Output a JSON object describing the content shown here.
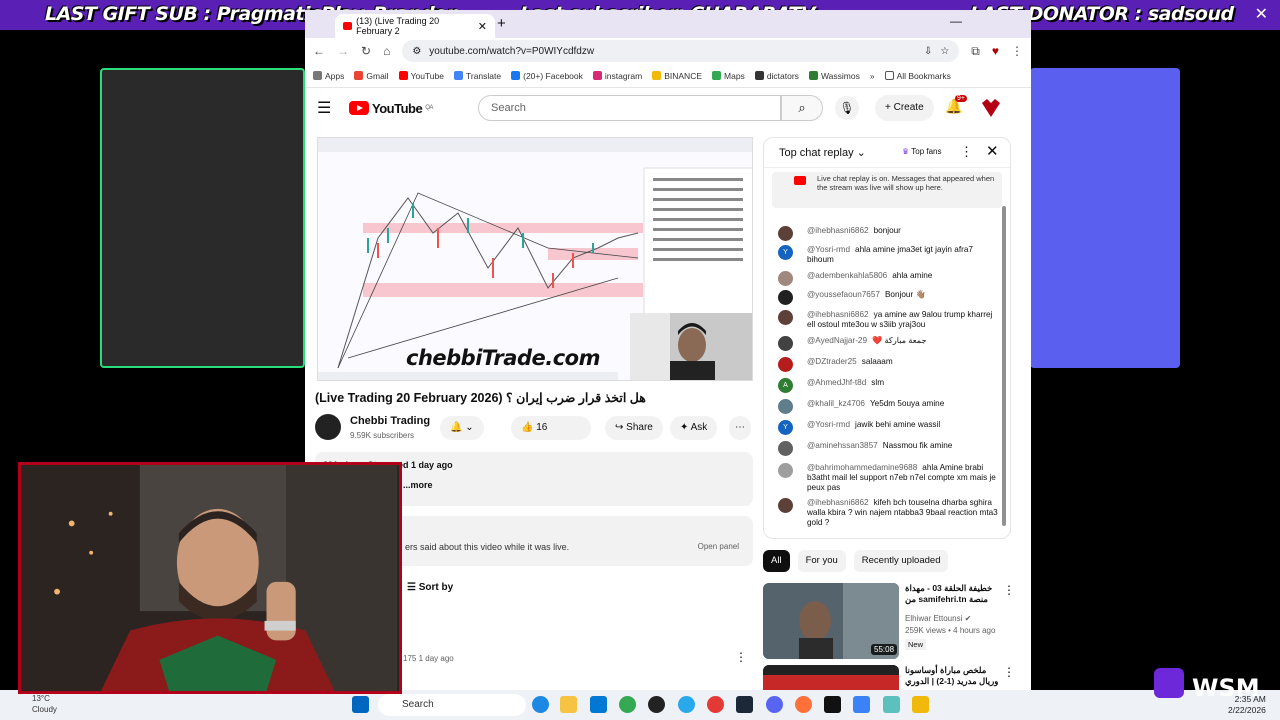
{
  "overlay": {
    "last_gift_sub": "LAST GIFT SUB : PragmaticPlay_Brandon",
    "last_subscriber": "Last subscriber: CHARARATV",
    "last_donator": "LAST DONATOR : sadsoud"
  },
  "browser": {
    "tab_title": "(13) (Live Trading 20 February 2",
    "url": "youtube.com/watch?v=P0WIYcdfdzw",
    "bookmarks": [
      "Apps",
      "Gmail",
      "YouTube",
      "Translate",
      "(20+) Facebook",
      "instagram",
      "BINANCE",
      "Maps",
      "dictators",
      "Wassimos"
    ],
    "all_bookmarks": "All Bookmarks"
  },
  "youtube": {
    "logo_text": "YouTube",
    "logo_country": "QA",
    "search_placeholder": "Search",
    "create_label": "Create",
    "notif_badge": "9+",
    "video_watermark": "chebbiTrade.com",
    "video_title": "(Live Trading 20 February 2026) هل اتخذ قرار ضرب إيران ؟",
    "channel_name": "Chebbi Trading",
    "channel_subs": "9.59K subscribers",
    "likes": "16",
    "share_label": "Share",
    "ask_label": "Ask",
    "desc_stats": "291 views  Streamed 1 day ago",
    "desc_more": "...more",
    "livechat_summary": "ers said about this video while it was live.",
    "open_panel": "Open panel",
    "sort_by": "Sort by",
    "comment_meta": "175  1 day ago"
  },
  "chat": {
    "header": "Top chat replay",
    "top_fans": "Top fans",
    "replay_note": "Live chat replay is on. Messages that appeared when the stream was live will show up here.",
    "messages": [
      {
        "author": "@ihebhasni6862",
        "text": "bonjour",
        "avatar_color": "#5d4037",
        "initial": ""
      },
      {
        "author": "@Yosri-rmd",
        "text": "ahla amine jma3et igt jayin afra7 bihoum",
        "avatar_color": "#1565c0",
        "initial": "Y"
      },
      {
        "author": "@adembenkahla5806",
        "text": "ahla amine",
        "avatar_color": "#a1887f",
        "initial": ""
      },
      {
        "author": "@youssefaoun7657",
        "text": "Bonjour 👋🏽",
        "avatar_color": "#212121",
        "initial": ""
      },
      {
        "author": "@ihebhasni6862",
        "text": "ya amine aw 9alou trump kharrej ell ostoul mte3ou w s3iib yraj3ou",
        "avatar_color": "#5d4037",
        "initial": ""
      },
      {
        "author": "@AyedNajjar-29",
        "text": "❤️ جمعة مباركة",
        "avatar_color": "#424242",
        "initial": ""
      },
      {
        "author": "@DZtrader25",
        "text": "salaaam",
        "avatar_color": "#b71c1c",
        "initial": ""
      },
      {
        "author": "@AhmedJhf-t8d",
        "text": "slm",
        "avatar_color": "#2e7d32",
        "initial": "A"
      },
      {
        "author": "@khalil_kz4706",
        "text": "Ye5dm 5ouya amine",
        "avatar_color": "#607d8b",
        "initial": ""
      },
      {
        "author": "@Yosri-rmd",
        "text": "jawik behi amine wassil",
        "avatar_color": "#1565c0",
        "initial": "Y"
      },
      {
        "author": "@aminehssan3857",
        "text": "Nassmou fik amine",
        "avatar_color": "#616161",
        "initial": ""
      },
      {
        "author": "@bahrimohammedamine9688",
        "text": "ahla Amine brabi b3atht mail lel support n7eb n7el compte xm mais je peux pas",
        "avatar_color": "#9e9e9e",
        "initial": ""
      },
      {
        "author": "@ihebhasni6862",
        "text": "kifeh bch touselna dharba sghira walla kbira ? win najem ntabba3 9baal reaction mta3 gold ?",
        "avatar_color": "#5d4037",
        "initial": ""
      }
    ]
  },
  "filters": [
    "All",
    "For you",
    "Recently uploaded"
  ],
  "recommendations": [
    {
      "title": "خطيفة الحلقة 03 - مهداة من samifehri.tn منصة",
      "channel": "Elhiwar Ettounsi",
      "views": "259K views • 4 hours ago",
      "badge": "New",
      "duration": "55:08"
    },
    {
      "title": "ملخص مباراة أوساسونا وريال مدريد (1-2) | الدوري ...",
      "channel": "",
      "views": "",
      "badge": "",
      "duration": ""
    }
  ],
  "taskbar": {
    "temp": "13°C",
    "weather": "Cloudy",
    "search": "Search",
    "time": "2:35 AM",
    "date": "2/22/2026"
  }
}
